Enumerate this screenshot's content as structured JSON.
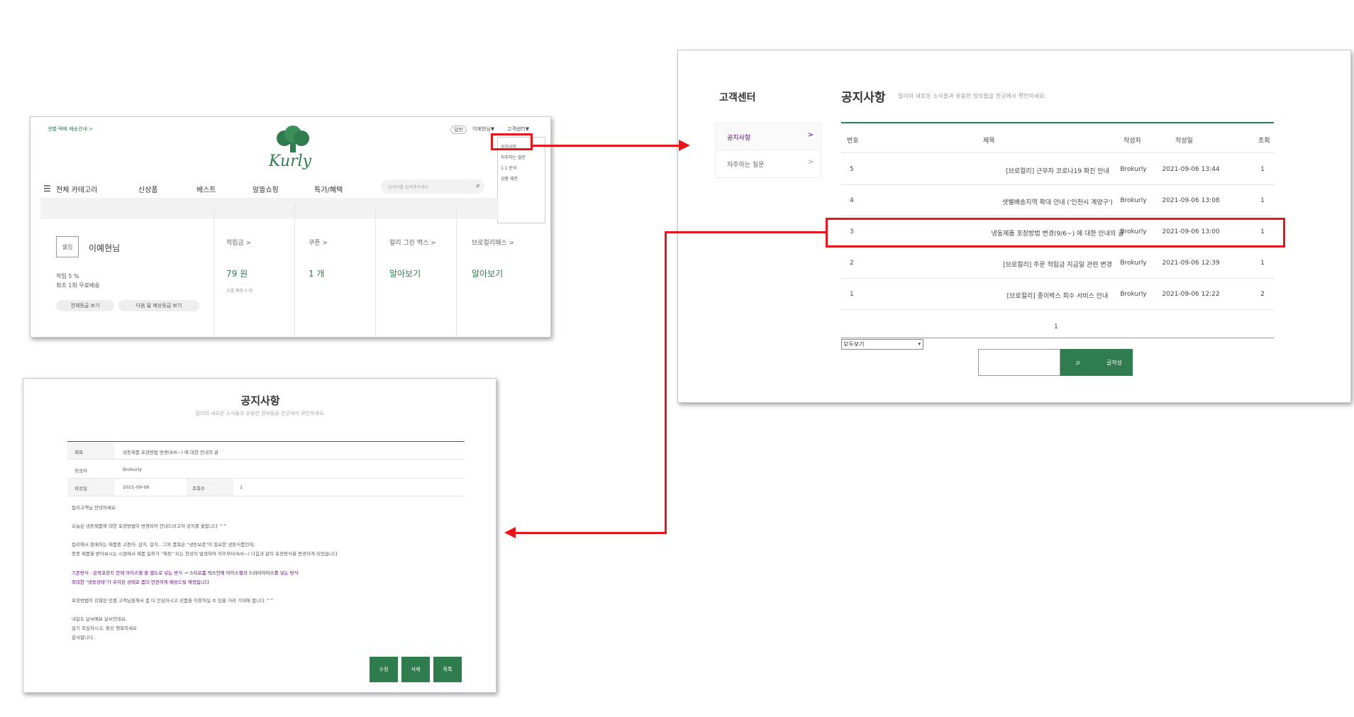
{
  "mypage": {
    "delivery_notice": "샛별·택배 배송안내 >",
    "top_links": [
      "일반",
      "이예현님▼",
      "고객센터▼"
    ],
    "logo_text": "Kurly",
    "cs_menu": [
      "공지사항",
      "자주하는 질문",
      "1:1 문의",
      "상품 제안"
    ],
    "nav": [
      "전체 카테고리",
      "신상품",
      "베스트",
      "알뜰쇼핑",
      "특가/혜택"
    ],
    "search_placeholder": "검색어를 입력해주세요",
    "grade_badge": "웰컴",
    "user_name": "이예현님",
    "benefit_line1": "적립 5 %",
    "benefit_line2": "최초 1회 무료배송",
    "btn_all_grades": "전체등급 보기",
    "btn_next_grade": "다음 달 예상등급 보기",
    "stats": [
      {
        "label": "적립금 >",
        "value": "79 원",
        "sub": "소멸 예정 0 원"
      },
      {
        "label": "쿠폰 >",
        "value": "1 개",
        "sub": ""
      },
      {
        "label": "컬리 그린 백스 >",
        "value": "알아보기",
        "sub": ""
      },
      {
        "label": "브로컬리패스 >",
        "value": "알아보기",
        "sub": ""
      }
    ]
  },
  "notice_list": {
    "sidebar_title": "고객센터",
    "sidebar_items": [
      {
        "label": "공지사항",
        "chevron": ">"
      },
      {
        "label": "자주하는 질문",
        "chevron": ">"
      }
    ],
    "title": "공지사항",
    "subtitle": "컬리의 새로운 소식들과 유용한 정보들을 한곳에서 확인하세요.",
    "columns": [
      "번호",
      "제목",
      "작성자",
      "작성일",
      "조회"
    ],
    "rows": [
      {
        "no": "5",
        "title": "[브로컬리] 근무자 코로나19 확진 안내",
        "author": "Brokurly",
        "date": "2021-09-06 13:44",
        "views": "1"
      },
      {
        "no": "4",
        "title": "샛별배송지역 확대 안내 ('인천시 계양구')",
        "author": "Brokurly",
        "date": "2021-09-06 13:08",
        "views": "1"
      },
      {
        "no": "3",
        "title": "냉동제품 포장방법 변경(9/6~) 에 대한 안내의 글",
        "author": "Brokurly",
        "date": "2021-09-06 13:00",
        "views": "1"
      },
      {
        "no": "2",
        "title": "[브로컬리] 주문 적립금 지급일 관련 변경",
        "author": "Brokurly",
        "date": "2021-09-06 12:39",
        "views": "1"
      },
      {
        "no": "1",
        "title": "[브로컬리] 종이박스 회수 서비스 안내",
        "author": "Brokurly",
        "date": "2021-09-06 12:22",
        "views": "2"
      }
    ],
    "page": "1",
    "filter_value": "모두보기",
    "search_icon": "search-icon",
    "write_label": "글작성"
  },
  "notice_detail": {
    "title": "공지사항",
    "subtitle": "컬리의 새로운 소식들과 유용한 정보들을 한곳에서 확인하세요.",
    "label_title": "제목",
    "value_title": "냉동제품 포장방법 변경(9/6~) 에 대한 안내의 글",
    "label_author": "작성자",
    "value_author": "Brokurly",
    "label_date": "작성일",
    "value_date": "2021-09-06",
    "label_views": "조회수",
    "value_views": "1",
    "body": [
      "컬리고객님 안녕하세요.",
      "오늘은 냉동제품에 대한 포장방법이 변경되어 안내드리고자 공지를 올립니다 ^^",
      "컬리에서 판매하는 제품중 고등어, 삼치, 갈치...그외 품목은 \"냉동보관\"이 필요한 냉동식품인데,",
      "종종 제품을 받아보시는 시점에서 제품 일부가 \"해동\" 되는 현상이 발생하여 자주부터(9/6~) 다음과 같이 포장방식을 변경하게 되었습니다",
      "기존방식 : 은박포장지 안에 아이스젤 을 별도로 넣는 방식 → 스티로폼 박스안에 아이스젤과 드라이아이스를 넣는 방식",
      "최대한 \"냉동상태\"가 유지된 상태로 좀더 안전하게 배송드릴 예정입니다",
      "포장방법이 강화된 만큼 고객님들께서 좀 더 안심하시고 상품을 이용하실 수 있을 거라 기대해 봅니다 ^^",
      "내일도 날씨예보 날씨인데요,",
      "감기 조심하시고, 항상 행복하세요",
      "감사합니다."
    ],
    "btn_edit": "수정",
    "btn_delete": "삭제",
    "btn_list": "목록"
  },
  "colors": {
    "brand_green": "#2f7d4f",
    "highlight_red": "#e8151d",
    "purple": "#5f0080"
  }
}
